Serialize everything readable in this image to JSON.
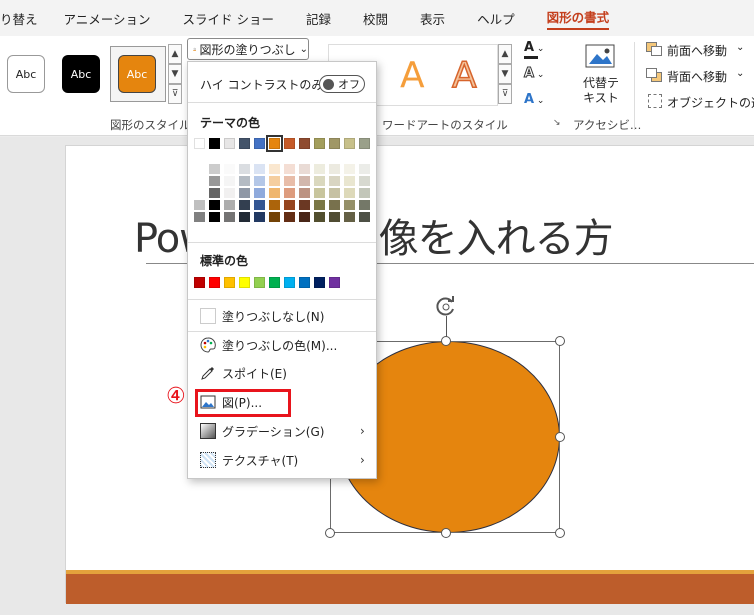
{
  "tabs": [
    "り替え",
    "アニメーション",
    "スライド ショー",
    "記録",
    "校閲",
    "表示",
    "ヘルプ",
    "図形の書式"
  ],
  "ribbon": {
    "shape_styles": [
      {
        "label": "Abc",
        "bg": "#ffffff",
        "fg": "#222222"
      },
      {
        "label": "Abc",
        "bg": "#000000",
        "fg": "#ffffff"
      },
      {
        "label": "Abc",
        "bg": "#e5850e",
        "fg": "#ffffff"
      }
    ],
    "fill_button_label": "図形の塗りつぶし",
    "shape_styles_group": "図形のスタイル",
    "wordart_group": "ワードアートのスタイル",
    "wordart_letter": "A",
    "alt_text_label": "代替テキスト",
    "accessibility_group": "アクセシビ…",
    "bring_forward": "前面へ移動",
    "send_backward": "背面へ移動",
    "selection_pane": "オブジェクトの選択と"
  },
  "menu": {
    "high_contrast_label": "ハイ コントラストのみ(H)",
    "toggle_label": "オフ",
    "theme_colors_heading": "テーマの色",
    "standard_colors_heading": "標準の色",
    "theme_colors": [
      "#ffffff",
      "#000000",
      "#e7e6e6",
      "#44546a",
      "#4472c4",
      "#e5850e",
      "#c65a28",
      "#8f4b2f",
      "#a39e5c",
      "#a09766",
      "#c7c08a",
      "#9aa08a"
    ],
    "standard_colors": [
      "#c00000",
      "#ff0000",
      "#ffc000",
      "#ffff00",
      "#92d050",
      "#00b050",
      "#00b0f0",
      "#0070c0",
      "#002060",
      "#7030a0"
    ],
    "no_fill": "塗りつぶしなし(N)",
    "more_colors": "塗りつぶしの色(M)...",
    "eyedropper": "スポイト(E)",
    "picture": "図(P)...",
    "gradient": "グラデーション(G)",
    "texture": "テクスチャ(T)",
    "step_marker": "④"
  },
  "slide": {
    "title": "Pow          図形に画像を入れる方"
  },
  "colors": {
    "accent": "#c43e1c",
    "shape_fill": "#e5850e",
    "highlight": "#e8141c",
    "band": "#bd5d2b"
  }
}
